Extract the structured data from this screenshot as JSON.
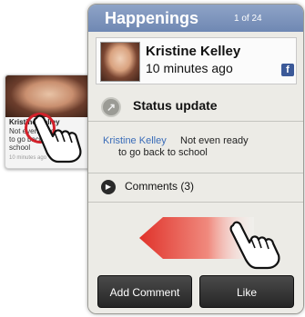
{
  "widget": {
    "title": "Happenings",
    "count": "1 of 24"
  },
  "post": {
    "name": "Kristine Kelley",
    "time": "10 minutes ago",
    "network_icon": "facebook-icon",
    "network_letter": "f"
  },
  "status": {
    "icon": "arrow-up-right-icon",
    "title": "Status update"
  },
  "message": {
    "author": "Kristine Kelley",
    "text_line1": "Not even ready",
    "text_line2": "to go back to school"
  },
  "comments": {
    "label": "Comments (3)"
  },
  "buttons": {
    "add_comment": "Add Comment",
    "like": "Like"
  },
  "thumbnail": {
    "name": "Kristine Kelley",
    "text": "Not even ready to go back to school",
    "time": "10 minutes ago"
  },
  "colors": {
    "header": "#7d95be",
    "swipe_arrow": "#e0322a",
    "link": "#3a6cb8",
    "highlight_circle": "#d3202a",
    "facebook": "#3b5998"
  }
}
